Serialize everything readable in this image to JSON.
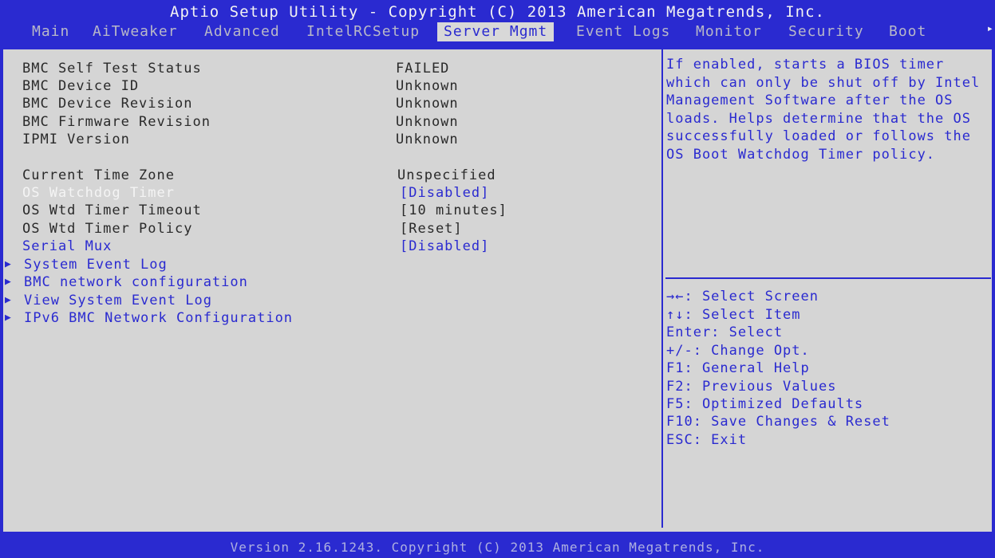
{
  "app": {
    "title": "Aptio Setup Utility - Copyright (C) 2013 American Megatrends, Inc.",
    "footer": "Version 2.16.1243. Copyright (C) 2013 American Megatrends, Inc."
  },
  "tabs": [
    "Main",
    "AiTweaker",
    "Advanced",
    "IntelRCSetup",
    "Server Mgmt",
    "Event Logs",
    "Monitor",
    "Security",
    "Boot"
  ],
  "active_tab": "Server Mgmt",
  "info_rows": [
    {
      "label": "BMC Self Test Status",
      "value": "FAILED"
    },
    {
      "label": "BMC Device ID",
      "value": "Unknown"
    },
    {
      "label": "BMC Device Revision",
      "value": "Unknown"
    },
    {
      "label": "BMC Firmware Revision",
      "value": "Unknown"
    },
    {
      "label": "IPMI Version",
      "value": "Unknown"
    }
  ],
  "settings": [
    {
      "label": "Current Time Zone",
      "value": "Unspecified"
    },
    {
      "label": "OS Watchdog Timer",
      "value": "[Disabled]"
    },
    {
      "label": "OS Wtd Timer Timeout",
      "value": "[10 minutes]"
    },
    {
      "label": "OS Wtd Timer Policy",
      "value": "[Reset]"
    },
    {
      "label": "Serial Mux",
      "value": "[Disabled]"
    }
  ],
  "submenus": [
    "System Event Log",
    "BMC network configuration",
    "View System Event Log",
    "IPv6 BMC Network Configuration"
  ],
  "help": {
    "description": "If enabled, starts a BIOS timer which can only be shut off by Intel Management Software after the OS loads. Helps determine that the OS successfully loaded or follows the OS Boot Watchdog Timer policy.",
    "keys": [
      "→←: Select Screen",
      "↑↓: Select Item",
      "Enter: Select",
      "+/-: Change Opt.",
      "F1: General Help",
      "F2: Previous Values",
      "F5: Optimized Defaults",
      "F10: Save Changes & Reset",
      "ESC: Exit"
    ]
  },
  "colors": {
    "background": "#2a2ad0",
    "panel": "#d5d5d5",
    "accent": "#2a2ad0",
    "selected_text": "#f4f4f4"
  },
  "icons": {
    "submenu": "triangle-right-icon",
    "scroll_right": "arrow-right-icon"
  }
}
